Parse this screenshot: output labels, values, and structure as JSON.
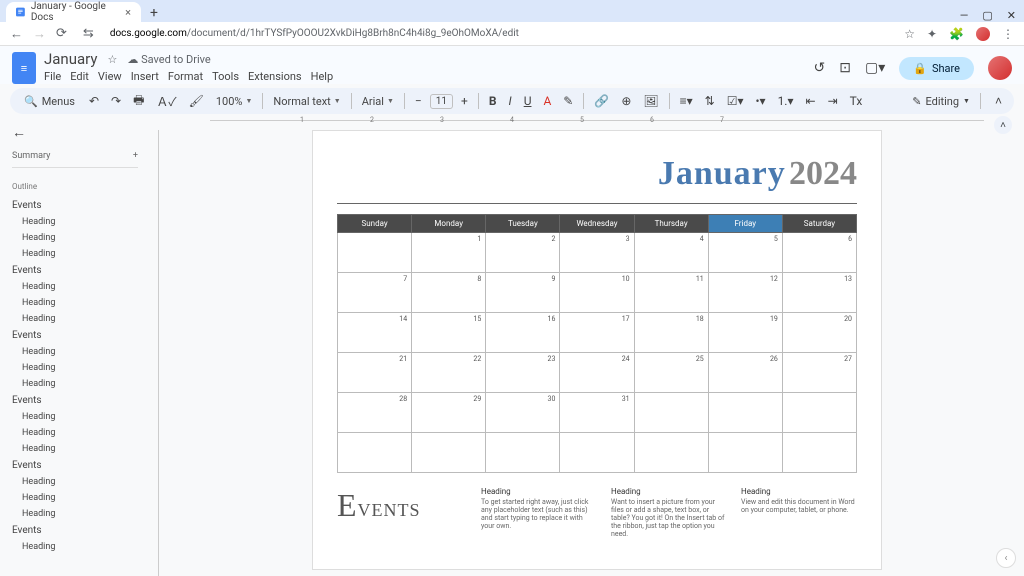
{
  "browser": {
    "tab_title": "January - Google Docs",
    "url_domain": "docs.google.com",
    "url_path": "/document/d/1hrTYSfPyOOOU2XvkDiHg8Brh8nC4h4i8g_9eOhOMoXA/edit",
    "close_x": "×",
    "new_tab": "+",
    "win_min": "—",
    "win_max": "▢",
    "win_close": "✕",
    "nav_back": "←",
    "nav_fwd": "→",
    "nav_reload": "⟳",
    "nav_secure": "⇆",
    "icons": {
      "star": "☆",
      "ext": "✦",
      "puzzle": "🧩",
      "dots": "⋮"
    }
  },
  "docs": {
    "title": "January",
    "save_state": "Saved to Drive",
    "menus": [
      "File",
      "Edit",
      "View",
      "Insert",
      "Format",
      "Tools",
      "Extensions",
      "Help"
    ],
    "header_icons": {
      "history": "↺",
      "comments": "⊡",
      "meet": "▢▾"
    },
    "share_label": "Share"
  },
  "toolbar": {
    "menus_btn": "Menus",
    "zoom": "100%",
    "style": "Normal text",
    "font": "Arial",
    "size": "11",
    "editing": "Editing"
  },
  "side": {
    "summary": "Summary",
    "plus": "+",
    "outline_label": "Outline",
    "groups": [
      {
        "title": "Events",
        "subs": [
          "Heading",
          "Heading",
          "Heading"
        ]
      },
      {
        "title": "Events",
        "subs": [
          "Heading",
          "Heading",
          "Heading"
        ]
      },
      {
        "title": "Events",
        "subs": [
          "Heading",
          "Heading",
          "Heading"
        ]
      },
      {
        "title": "Events",
        "subs": [
          "Heading",
          "Heading",
          "Heading"
        ]
      },
      {
        "title": "Events",
        "subs": [
          "Heading",
          "Heading",
          "Heading"
        ]
      },
      {
        "title": "Events",
        "subs": [
          "Heading"
        ]
      }
    ]
  },
  "calendar": {
    "month": "January",
    "year": "2024",
    "days": [
      "Sunday",
      "Monday",
      "Tuesday",
      "Wednesday",
      "Thursday",
      "Friday",
      "Saturday"
    ],
    "weeks": [
      [
        "",
        "1",
        "2",
        "3",
        "4",
        "5",
        "6"
      ],
      [
        "7",
        "8",
        "9",
        "10",
        "11",
        "12",
        "13"
      ],
      [
        "14",
        "15",
        "16",
        "17",
        "18",
        "19",
        "20"
      ],
      [
        "21",
        "22",
        "23",
        "24",
        "25",
        "26",
        "27"
      ],
      [
        "28",
        "29",
        "30",
        "31",
        "",
        "",
        ""
      ],
      [
        "",
        "",
        "",
        "",
        "",
        "",
        ""
      ]
    ]
  },
  "events": {
    "title": "Events",
    "cols": [
      {
        "h": "Heading",
        "t": "To get started right away, just click any placeholder text (such as this) and start typing to replace it with your own."
      },
      {
        "h": "Heading",
        "t": "Want to insert a picture from your files or add a shape, text box, or table? You got it! On the Insert tab of the ribbon, just tap the option you need."
      },
      {
        "h": "Heading",
        "t": "View and edit this document in Word on your computer, tablet, or phone."
      }
    ]
  },
  "ruler_marks": [
    "",
    "1",
    "2",
    "3",
    "4",
    "5",
    "6",
    "7"
  ]
}
